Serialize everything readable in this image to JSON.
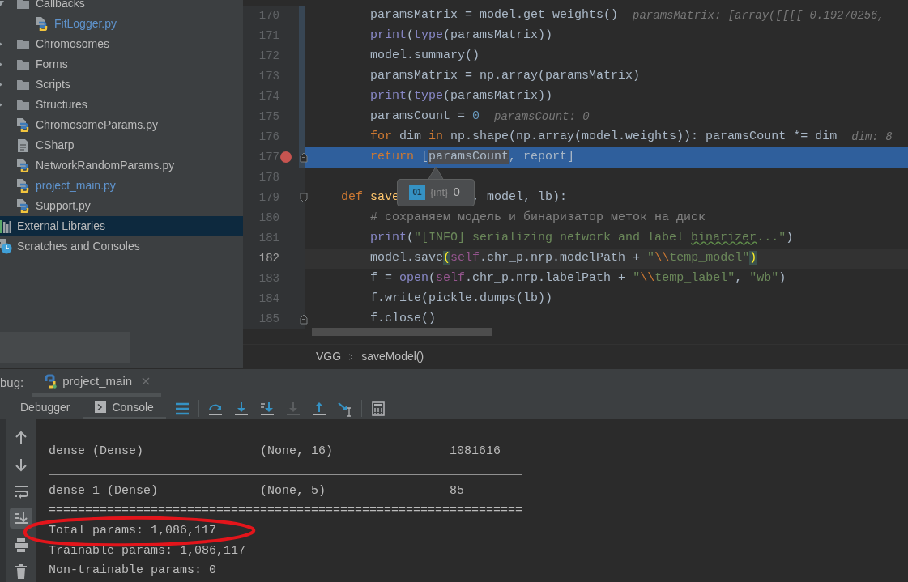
{
  "sidebar": {
    "project_items": [
      {
        "label": "Callbacks",
        "kind": "folder",
        "expanded": true,
        "modified": false,
        "selected": false,
        "children": [
          {
            "label": "FitLogger.py",
            "kind": "python",
            "modified": true,
            "selected": false
          }
        ]
      },
      {
        "label": "Chromosomes",
        "kind": "folder",
        "expanded": false,
        "modified": false,
        "selected": false
      },
      {
        "label": "Forms",
        "kind": "folder",
        "expanded": false,
        "modified": false,
        "selected": false
      },
      {
        "label": "Scripts",
        "kind": "folder",
        "expanded": false,
        "modified": false,
        "selected": false
      },
      {
        "label": "Structures",
        "kind": "folder",
        "expanded": false,
        "modified": false,
        "selected": false
      },
      {
        "label": "ChromosomeParams.py",
        "kind": "python",
        "modified": false,
        "selected": false
      },
      {
        "label": "CSharp",
        "kind": "text",
        "modified": false,
        "selected": false
      },
      {
        "label": "NetworkRandomParams.py",
        "kind": "python",
        "modified": false,
        "selected": false
      },
      {
        "label": "project_main.py",
        "kind": "python",
        "modified": true,
        "selected": false
      },
      {
        "label": "Support.py",
        "kind": "python",
        "modified": false,
        "selected": false
      }
    ],
    "root_items": [
      {
        "label": "External Libraries",
        "kind": "libraries",
        "modified": false,
        "selected": true
      },
      {
        "label": "Scratches and Consoles",
        "kind": "scratches",
        "modified": false,
        "selected": false
      }
    ]
  },
  "editor": {
    "lines": [
      {
        "number": "170",
        "breakpoint": false,
        "current": false,
        "caret": false,
        "changed": true,
        "tokens": [
          {
            "kind": "plain",
            "t": "        paramsMatrix = model.get_weights()"
          },
          {
            "kind": "hint",
            "t": "paramsMatrix: [array([[[[ 0.19270256,"
          }
        ]
      },
      {
        "number": "171",
        "breakpoint": false,
        "current": false,
        "caret": false,
        "changed": true,
        "tokens": [
          {
            "kind": "builtin",
            "t": "        print"
          },
          {
            "kind": "plain",
            "t": "("
          },
          {
            "kind": "builtin",
            "t": "type"
          },
          {
            "kind": "plain",
            "t": "(paramsMatrix))"
          }
        ]
      },
      {
        "number": "172",
        "breakpoint": false,
        "current": false,
        "caret": false,
        "changed": true,
        "tokens": [
          {
            "kind": "plain",
            "t": "        model.summary()"
          }
        ]
      },
      {
        "number": "173",
        "breakpoint": false,
        "current": false,
        "caret": false,
        "changed": true,
        "tokens": [
          {
            "kind": "plain",
            "t": "        paramsMatrix = np.array(paramsMatrix)"
          }
        ]
      },
      {
        "number": "174",
        "breakpoint": false,
        "current": false,
        "caret": false,
        "changed": true,
        "tokens": [
          {
            "kind": "builtin",
            "t": "        print"
          },
          {
            "kind": "plain",
            "t": "("
          },
          {
            "kind": "builtin",
            "t": "type"
          },
          {
            "kind": "plain",
            "t": "(paramsMatrix))"
          }
        ]
      },
      {
        "number": "175",
        "breakpoint": false,
        "current": false,
        "caret": false,
        "changed": true,
        "tokens": [
          {
            "kind": "plain",
            "t": "        paramsCount = "
          },
          {
            "kind": "num",
            "t": "0"
          },
          {
            "kind": "hint",
            "t": "paramsCount: 0"
          }
        ]
      },
      {
        "number": "176",
        "breakpoint": false,
        "current": false,
        "caret": false,
        "changed": true,
        "tokens": [
          {
            "kind": "kw",
            "t": "        for"
          },
          {
            "kind": "plain",
            "t": " dim "
          },
          {
            "kind": "kw",
            "t": "in"
          },
          {
            "kind": "plain",
            "t": " np.shape(np.array(model.weights)): paramsCount *= dim"
          },
          {
            "kind": "hint",
            "t": "dim: 8"
          }
        ]
      },
      {
        "number": "177",
        "breakpoint": true,
        "current": true,
        "caret": false,
        "changed": true,
        "fold": {
          "kind": "end"
        },
        "tokens": [
          {
            "kind": "kw",
            "t": "        return"
          },
          {
            "kind": "plain",
            "t": " ["
          },
          {
            "kind": "hl",
            "t": "paramsCount"
          },
          {
            "kind": "plain",
            "t": ", report]"
          }
        ]
      },
      {
        "number": "178",
        "breakpoint": false,
        "current": false,
        "caret": false,
        "changed": false
      },
      {
        "number": "179",
        "breakpoint": false,
        "current": false,
        "caret": false,
        "changed": false,
        "fold": {
          "kind": "start"
        },
        "tokens": [
          {
            "kind": "kw",
            "t": "    def "
          },
          {
            "kind": "defname",
            "t": "save"
          },
          {
            "kind": "popup"
          },
          {
            "kind": "plain",
            "t": ", model, lb):"
          }
        ]
      },
      {
        "number": "180",
        "breakpoint": false,
        "current": false,
        "caret": false,
        "changed": false,
        "tokens": [
          {
            "kind": "comment",
            "t": "        # сохраняем модель и бинаризатор меток на диск"
          }
        ]
      },
      {
        "number": "181",
        "breakpoint": false,
        "current": false,
        "caret": false,
        "changed": false,
        "tokens": [
          {
            "kind": "builtin",
            "t": "        print"
          },
          {
            "kind": "plain",
            "t": "("
          },
          {
            "kind": "str",
            "t": "\"[INFO] serializing network and label "
          },
          {
            "kind": "typo",
            "t": "binarizer"
          },
          {
            "kind": "str",
            "t": "...\""
          },
          {
            "kind": "plain",
            "t": ")"
          }
        ]
      },
      {
        "number": "182",
        "breakpoint": false,
        "current": false,
        "caret": true,
        "changed": false,
        "tokens": [
          {
            "kind": "plain",
            "t": "        model.save"
          },
          {
            "kind": "brace",
            "t": "("
          },
          {
            "kind": "self",
            "t": "self"
          },
          {
            "kind": "plain",
            "t": ".chr_p.nrp.modelPath + "
          },
          {
            "kind": "str",
            "t": "\""
          },
          {
            "kind": "esc",
            "t": "\\\\"
          },
          {
            "kind": "str",
            "t": "temp_model\""
          },
          {
            "kind": "brace",
            "t": ")"
          }
        ]
      },
      {
        "number": "183",
        "breakpoint": false,
        "current": false,
        "caret": false,
        "changed": false,
        "tokens": [
          {
            "kind": "plain",
            "t": "        f = "
          },
          {
            "kind": "builtin",
            "t": "open"
          },
          {
            "kind": "plain",
            "t": "("
          },
          {
            "kind": "self",
            "t": "self"
          },
          {
            "kind": "plain",
            "t": ".chr_p.nrp.labelPath + "
          },
          {
            "kind": "str",
            "t": "\""
          },
          {
            "kind": "esc",
            "t": "\\\\"
          },
          {
            "kind": "str",
            "t": "temp_label\""
          },
          {
            "kind": "plain",
            "t": ", "
          },
          {
            "kind": "str",
            "t": "\"wb\""
          },
          {
            "kind": "plain",
            "t": ")"
          }
        ]
      },
      {
        "number": "184",
        "breakpoint": false,
        "current": false,
        "caret": false,
        "changed": false,
        "tokens": [
          {
            "kind": "plain",
            "t": "        f.write(pickle.dumps(lb))"
          }
        ]
      },
      {
        "number": "185",
        "breakpoint": false,
        "current": false,
        "caret": false,
        "changed": false,
        "fold": {
          "kind": "end"
        },
        "tokens": [
          {
            "kind": "plain",
            "t": "        f.close()"
          }
        ]
      }
    ],
    "popup": {
      "badge": "01",
      "type": "{int}",
      "value": "0"
    },
    "breadcrumbs": [
      "VGG",
      "saveModel()"
    ]
  },
  "debug": {
    "label": "bug:",
    "tabs": [
      {
        "label": "project_main",
        "selected": true
      }
    ],
    "view_tabs": [
      {
        "label": "Debugger",
        "kind": "plain",
        "selected": false
      },
      {
        "label": "Console",
        "kind": "console",
        "selected": true
      }
    ],
    "action_groups": [
      [
        {
          "kind": "menu",
          "disabled": false
        }
      ],
      [
        {
          "kind": "step_over",
          "disabled": false
        },
        {
          "kind": "step_into",
          "disabled": false
        },
        {
          "kind": "step_into_my_code",
          "disabled": false
        },
        {
          "kind": "force_step_into",
          "disabled": true
        },
        {
          "kind": "step_out",
          "disabled": false
        },
        {
          "kind": "run_to_cursor",
          "disabled": false
        }
      ],
      [
        {
          "kind": "evaluate",
          "disabled": false
        }
      ]
    ],
    "side_actions": [
      {
        "kind": "up",
        "selected": false
      },
      {
        "kind": "down",
        "selected": false
      },
      {
        "kind": "wrap",
        "selected": false
      },
      {
        "kind": "scroll_end",
        "selected": true
      },
      {
        "kind": "print",
        "selected": false
      },
      {
        "kind": "clear",
        "selected": false
      }
    ],
    "console_lines": [
      "_________________________________________________________________",
      "dense (Dense)                (None, 16)                1081616",
      "_________________________________________________________________",
      "dense_1 (Dense)              (None, 5)                 85",
      "=================================================================",
      "Total params: 1,086,117",
      "Trainable params: 1,086,117",
      "Non-trainable params: 0"
    ]
  }
}
